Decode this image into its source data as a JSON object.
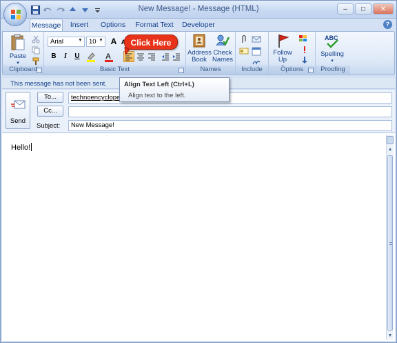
{
  "window": {
    "title": "New Message! - Message (HTML)",
    "controls": {
      "minimize": "–",
      "maximize": "□",
      "close": "✕"
    }
  },
  "quick_access": [
    "save-icon",
    "undo-icon",
    "redo-icon",
    "up-arrow-icon",
    "down-arrow-icon",
    "customize-icon"
  ],
  "tabs": [
    {
      "label": "Message",
      "active": true
    },
    {
      "label": "Insert",
      "active": false
    },
    {
      "label": "Options",
      "active": false
    },
    {
      "label": "Format Text",
      "active": false
    },
    {
      "label": "Developer",
      "active": false
    }
  ],
  "ribbon": {
    "clipboard": {
      "label": "Clipboard",
      "paste": "Paste"
    },
    "basic_text": {
      "label": "Basic Text",
      "font": "Arial",
      "size": "10",
      "bold": "B",
      "italic": "I",
      "underline": "U",
      "grow_font": "A",
      "shrink_font": "A"
    },
    "names": {
      "label": "Names",
      "address_book": "Address Book",
      "check_names": "Check Names"
    },
    "include": {
      "label": "Include"
    },
    "options": {
      "label": "Options",
      "follow_up": "Follow Up"
    },
    "proofing": {
      "label": "Proofing",
      "spelling": "Spelling",
      "spelling_icon_text": "ABC"
    }
  },
  "callout": {
    "text": "Click Here",
    "color": "#e8331a"
  },
  "tooltip": {
    "title": "Align Text Left (Ctrl+L)",
    "description": "Align text to the left."
  },
  "info_bar": "This message has not been sent.",
  "header": {
    "send": "Send",
    "to_button": "To...",
    "to_value": "technoencyclopedia@",
    "cc_button": "Cc...",
    "cc_value": "",
    "subject_label": "Subject:",
    "subject_value": "New Message!"
  },
  "body": {
    "text": "Hello!"
  },
  "colors": {
    "accent": "#15428b",
    "ribbon": "#dde8f7",
    "highlight": "#f6b64b"
  }
}
